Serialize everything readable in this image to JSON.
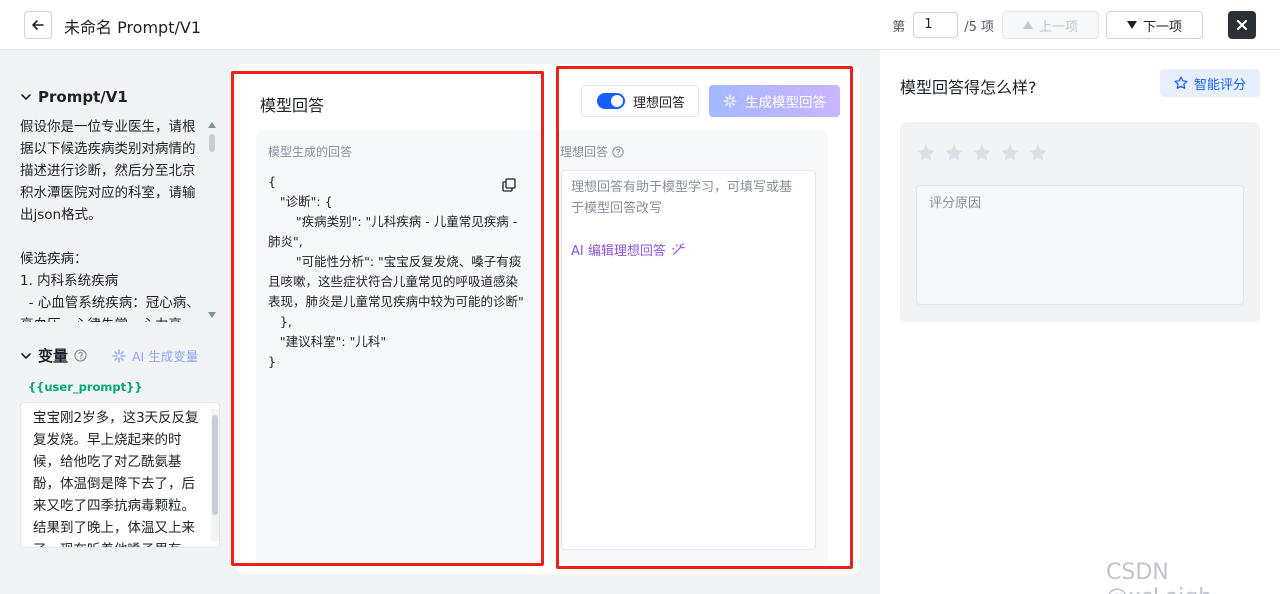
{
  "header": {
    "title": "未命名 Prompt/V1",
    "pager_prefix": "第",
    "page_current": "1",
    "pager_suffix": "/5 项",
    "prev_label": "上一项",
    "next_label": "下一项"
  },
  "left": {
    "prompt_heading": "Prompt/V1",
    "prompt_text": "假设你是一位专业医生，请根据以下候选疾病类别对病情的描述进行诊断，然后分至北京积水潭医院对应的科室，请输出json格式。\n\n候选疾病：\n1. 内科系统疾病\n  - 心血管系统疾病：冠心病、高血压、心律失常、心力衰",
    "variables_heading": "变量",
    "ai_generate_label": "AI 生成变量",
    "variable_tag": "{{user_prompt}}",
    "variable_text": "宝宝刚2岁多，这3天反反复复发烧。早上烧起来的时候，给他吃了对乙酰氨基酚，体温倒是降下去了，后来又吃了四季抗病毒颗粒。结果到了晚上，体温又上来了，现在听着他嗓子里有"
  },
  "center": {
    "title": "模型回答",
    "gen_label": "模型生成的回答",
    "json_output": "{\n   \"诊断\": {\n       \"疾病类别\": \"儿科疾病 - 儿童常见疾病 - 肺炎\",\n       \"可能性分析\": \"宝宝反复发烧、嗓子有痰且咳嗽，这些症状符合儿童常见的呼吸道感染表现，肺炎是儿童常见疾病中较为可能的诊断\"\n   },\n   \"建议科室\": \"儿科\"\n}",
    "toggle_label": "理想回答",
    "generate_button": "生成模型回答",
    "ideal_label": "理想回答",
    "ideal_placeholder": "理想回答有助于模型学习，可填写或基于模型回答改写",
    "ai_edit_label": "AI 编辑理想回答"
  },
  "right": {
    "question": "模型回答得怎么样?",
    "smart_rate_label": "智能评分",
    "rating": 0,
    "rating_max": 5,
    "reason_placeholder": "评分原因"
  },
  "watermark": "CSDN @xcLeigh",
  "colors": {
    "primary": "#165dff",
    "highlight_frame": "#e8231b",
    "variable_tag": "#00a870",
    "ai_purple": "#9254de"
  }
}
